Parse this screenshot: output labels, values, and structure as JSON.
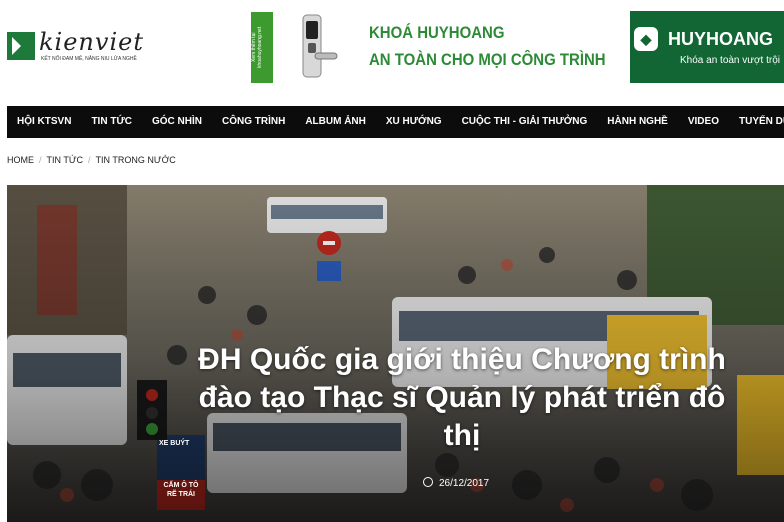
{
  "logo": {
    "name": "kienviet",
    "tagline": "KẾT NỐI ĐAM MÊ, NÂNG NIU LỬA NGHỀ"
  },
  "ad_left": {
    "strip_text": "Xem thêm tại khoahuyhoang.net",
    "line1": "KHOÁ HUYHOANG",
    "line2": "AN TOÀN CHO MỌI CÔNG TRÌNH"
  },
  "ad_right": {
    "brand": "HUYHOANG",
    "slogan": "Khóa an toàn vượt trội"
  },
  "nav": [
    "HỘI KTSVN",
    "TIN TỨC",
    "GÓC NHÌN",
    "CÔNG TRÌNH",
    "ALBUM ẢNH",
    "XU HƯỚNG",
    "CUỘC THI - GIẢI THƯỞNG",
    "HÀNH NGHỀ",
    "VIDEO",
    "TUYỂN DỤNG"
  ],
  "breadcrumb": [
    "HOME",
    "TIN TỨC",
    "TIN TRONG NƯỚC"
  ],
  "hero": {
    "title": "ĐH Quốc gia giới thiệu Chương trình đào tạo Thạc sĩ Quản lý phát triển đô thị",
    "date": "26/12/2017",
    "sign_text": "XE BUÝT",
    "sign_text2": "CẤM Ô TÔ RẼ TRÁI"
  },
  "colors": {
    "brand_green": "#1e7a3a",
    "ad_green": "#2d8a36",
    "nav_bg": "#0c0c0c"
  }
}
